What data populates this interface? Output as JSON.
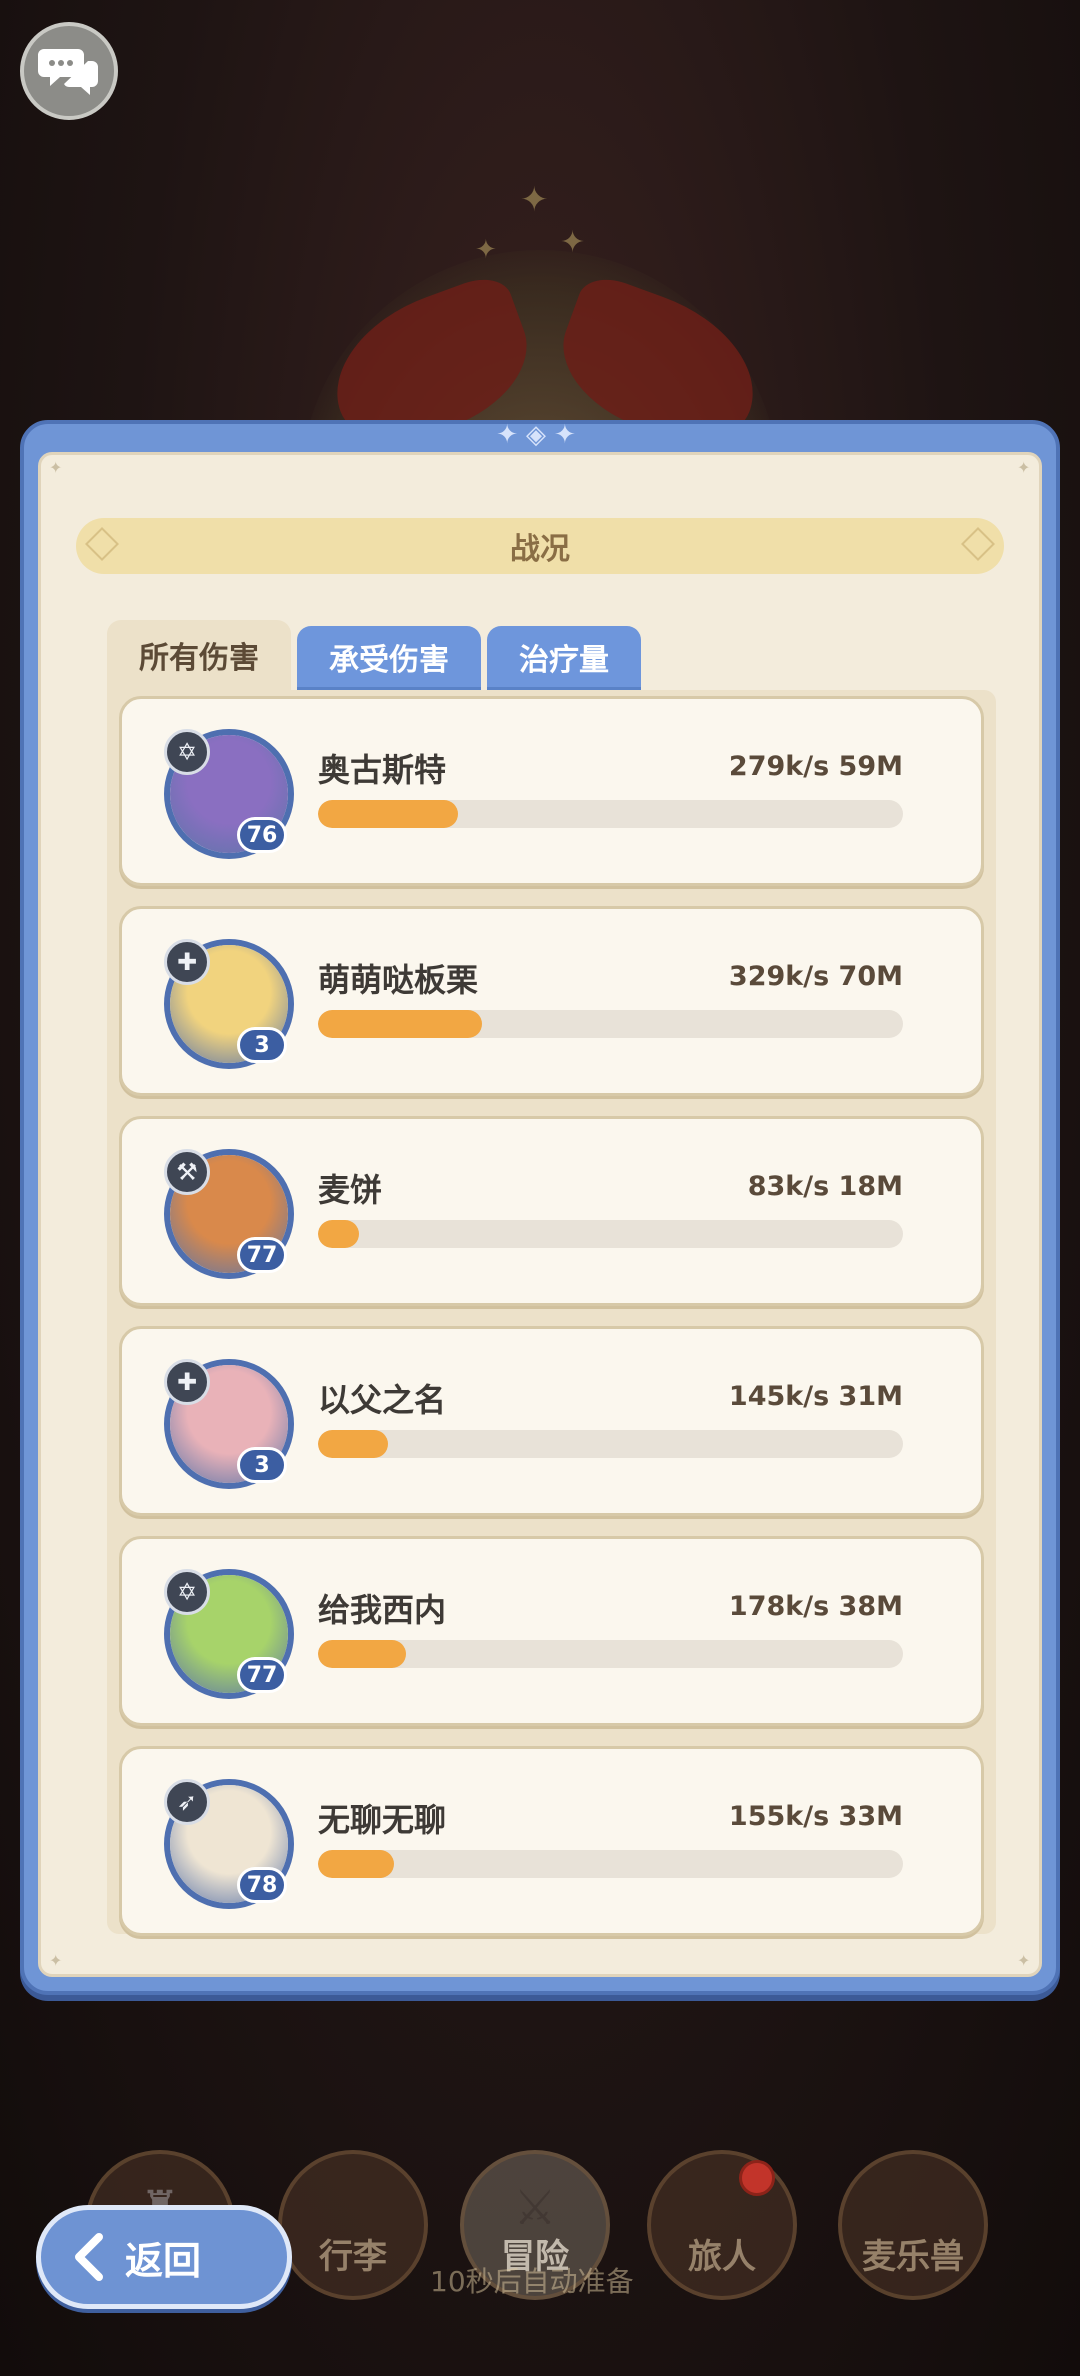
{
  "panel": {
    "title": "战况"
  },
  "tabs": [
    {
      "label": "所有伤害",
      "active": true
    },
    {
      "label": "承受伤害",
      "active": false
    },
    {
      "label": "治疗量",
      "active": false
    }
  ],
  "rows": [
    {
      "name": "奥古斯特",
      "stat": "279k/s 59M",
      "level": "76",
      "role_icon": "star-of-david-icon",
      "progress": 0.24,
      "avatar_color": "#8a6fc1"
    },
    {
      "name": "萌萌哒板栗",
      "stat": "329k/s 70M",
      "level": "3",
      "role_icon": "cross-icon",
      "progress": 0.28,
      "avatar_color": "#f1d37e"
    },
    {
      "name": "麦饼",
      "stat": "83k/s 18M",
      "level": "77",
      "role_icon": "hammer-icon",
      "progress": 0.07,
      "avatar_color": "#d9894b"
    },
    {
      "name": "以父之名",
      "stat": "145k/s 31M",
      "level": "3",
      "role_icon": "cross-icon",
      "progress": 0.12,
      "avatar_color": "#e9b2b8"
    },
    {
      "name": "给我西内",
      "stat": "178k/s 38M",
      "level": "77",
      "role_icon": "star-of-david-icon",
      "progress": 0.15,
      "avatar_color": "#a7d36a"
    },
    {
      "name": "无聊无聊",
      "stat": "155k/s 33M",
      "level": "78",
      "role_icon": "arrow-icon",
      "progress": 0.13,
      "avatar_color": "#efe5d3"
    }
  ],
  "back_button": {
    "label": "返回"
  },
  "bottom_nav": {
    "items": [
      {
        "label": ""
      },
      {
        "label": "行李"
      },
      {
        "label": "冒险"
      },
      {
        "label": "旅人"
      },
      {
        "label": "麦乐兽"
      }
    ],
    "hint": "10秒后自动准备"
  },
  "colors": {
    "panel_blue": "#6f95d6",
    "progress_fill": "#f2a743",
    "card_bg": "#fbf7ee"
  }
}
